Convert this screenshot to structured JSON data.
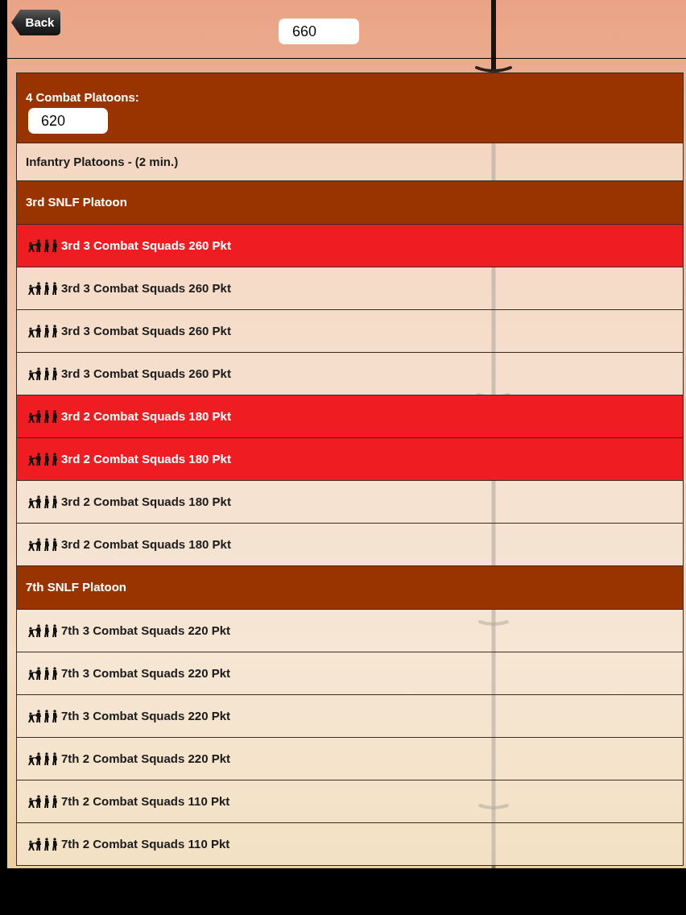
{
  "top_bar": {
    "back_button": "Back",
    "total_field": "660"
  },
  "list": {
    "header": {
      "label": "4 Combat Platoons:",
      "value": "620"
    },
    "rows": [
      {
        "kind": "category",
        "label": "Infantry Platoons - (2 min.)"
      },
      {
        "kind": "platoon",
        "label": "3rd SNLF Platoon"
      },
      {
        "kind": "unit",
        "label": "3rd 3 Combat Squads 260 Pkt",
        "selected": true
      },
      {
        "kind": "unit",
        "label": "3rd 3 Combat Squads 260 Pkt",
        "selected": false
      },
      {
        "kind": "unit",
        "label": "3rd 3 Combat Squads 260 Pkt",
        "selected": false
      },
      {
        "kind": "unit",
        "label": "3rd 3 Combat Squads 260 Pkt",
        "selected": false
      },
      {
        "kind": "unit",
        "label": "3rd 2 Combat Squads 180 Pkt",
        "selected": true
      },
      {
        "kind": "unit",
        "label": "3rd 2 Combat Squads 180 Pkt",
        "selected": true
      },
      {
        "kind": "unit",
        "label": "3rd 2 Combat Squads 180 Pkt",
        "selected": false
      },
      {
        "kind": "unit",
        "label": "3rd 2 Combat Squads 180 Pkt",
        "selected": false
      },
      {
        "kind": "platoon",
        "label": "7th SNLF Platoon"
      },
      {
        "kind": "unit",
        "label": "7th 3 Combat Squads 220 Pkt",
        "selected": false
      },
      {
        "kind": "unit",
        "label": "7th 3 Combat Squads 220 Pkt",
        "selected": false
      },
      {
        "kind": "unit",
        "label": "7th 3 Combat Squads 220 Pkt",
        "selected": false
      },
      {
        "kind": "unit",
        "label": "7th 2 Combat Squads 220 Pkt",
        "selected": false
      },
      {
        "kind": "unit",
        "label": "7th 2 Combat Squads 110 Pkt",
        "selected": false
      },
      {
        "kind": "unit",
        "label": "7th 2 Combat Squads 110 Pkt",
        "selected": false
      }
    ]
  }
}
